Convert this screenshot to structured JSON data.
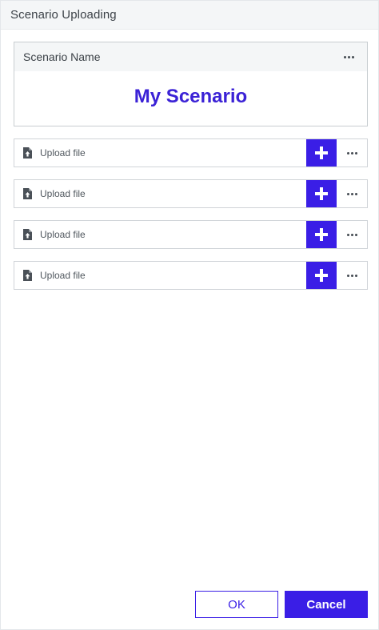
{
  "dialog": {
    "title": "Scenario Uploading"
  },
  "scenario": {
    "label": "Scenario Name",
    "value": "My Scenario"
  },
  "uploads": [
    {
      "label": "Upload file"
    },
    {
      "label": "Upload file"
    },
    {
      "label": "Upload file"
    },
    {
      "label": "Upload file"
    }
  ],
  "actions": {
    "ok_label": "OK",
    "cancel_label": "Cancel"
  },
  "colors": {
    "accent": "#3a1ee6",
    "title_accent": "#3b22d6",
    "header_bg": "#f4f6f7"
  },
  "icons": {
    "upload_row": "file-upload-icon",
    "add": "plus-icon",
    "more": "ellipsis-icon"
  }
}
